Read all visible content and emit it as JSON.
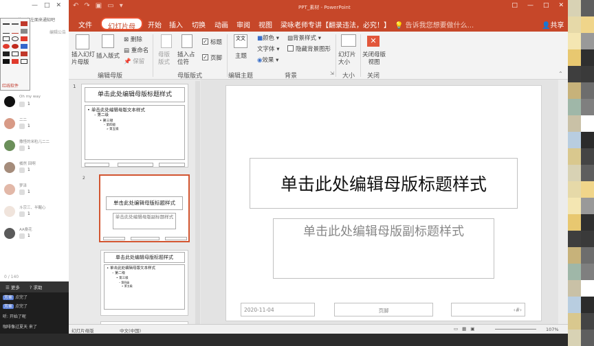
{
  "app_window": {
    "title": "PPT_素材 - PowerPoint",
    "controls": [
      "□",
      "—",
      "□",
      "✕"
    ]
  },
  "tabs": [
    "文件",
    "幻灯片母版",
    "开始",
    "插入",
    "切换",
    "动画",
    "审阅",
    "视图",
    "梁咏老师专讲【翻录违法，必究！】"
  ],
  "tell_me": "告诉我您想要做什么...",
  "share": "共享",
  "ribbon": {
    "insert_slide_master": "插入幻灯片母版",
    "insert_layout": "插入版式",
    "delete": "删除",
    "rename": "重命名",
    "preserve": "保留",
    "master_layout": "母版版式",
    "insert_placeholder": "插入占位符",
    "title_check": "标题",
    "footer_check": "页脚",
    "theme": "主题",
    "colors": "颜色",
    "fonts": "字体",
    "effects": "效果",
    "background_styles": "背景样式",
    "hide_bg_graphics": "隐藏背景图形",
    "slide_size": "幻灯片大小",
    "close_master_view": "关闭母版视图",
    "groups": [
      "编辑母版",
      "母版版式",
      "编辑主题",
      "背景",
      "大小",
      "关闭"
    ]
  },
  "thumbnails": {
    "t1_title": "单击此处编辑母版标题样式",
    "t1_body": [
      "• 单击此处编辑母版文本样式",
      "– 第二级",
      "• 第三级",
      "– 第四级",
      "» 第五级"
    ],
    "t2_title": "单击此处编辑母版标题样式",
    "t2_sub": "单击此处编辑母版副标题样式",
    "t3_title": "单击此处编辑母版标题样式",
    "t3_body": [
      "• 单击此处编辑母版文本样式",
      "– 第二级",
      "• 第三级",
      "– 第四级",
      "» 第五级"
    ],
    "numbers": [
      "1",
      "2"
    ]
  },
  "slide": {
    "title": "单击此处编辑母版标题样式",
    "subtitle": "单击此处编辑母版副标题样式",
    "date": "2020-11-04",
    "footer": "页脚",
    "page_num": "‹#›"
  },
  "status": {
    "view": "幻灯片母版",
    "language": "中文(中国)",
    "zoom": "107%"
  },
  "chat": {
    "notice": "快哥点左面来通知吧",
    "notice_label": "编辑公告",
    "items": [
      {
        "name": "Oh my way",
        "count": "1"
      },
      {
        "name": "二二",
        "count": "1"
      },
      {
        "name": "撒怪的米粒儿二二",
        "count": "1"
      },
      {
        "name": "橘然 回啊",
        "count": "1"
      },
      {
        "name": "梦泽",
        "count": "1"
      },
      {
        "name": "斗宗三、半醒心",
        "count": "1"
      },
      {
        "name": "AA桑花",
        "count": "1"
      }
    ],
    "counter": "0 / 140",
    "more": "更多",
    "help": "求助",
    "messages": [
      {
        "tag": "芳家",
        "text": "点完了"
      },
      {
        "tag": "芳家",
        "text": "点完了"
      },
      {
        "tag": "",
        "text": "听: 开始了呢"
      },
      {
        "tag": "",
        "text": "咖啡像过夏天  来了"
      }
    ]
  },
  "palette": {
    "title": "红线软件"
  }
}
